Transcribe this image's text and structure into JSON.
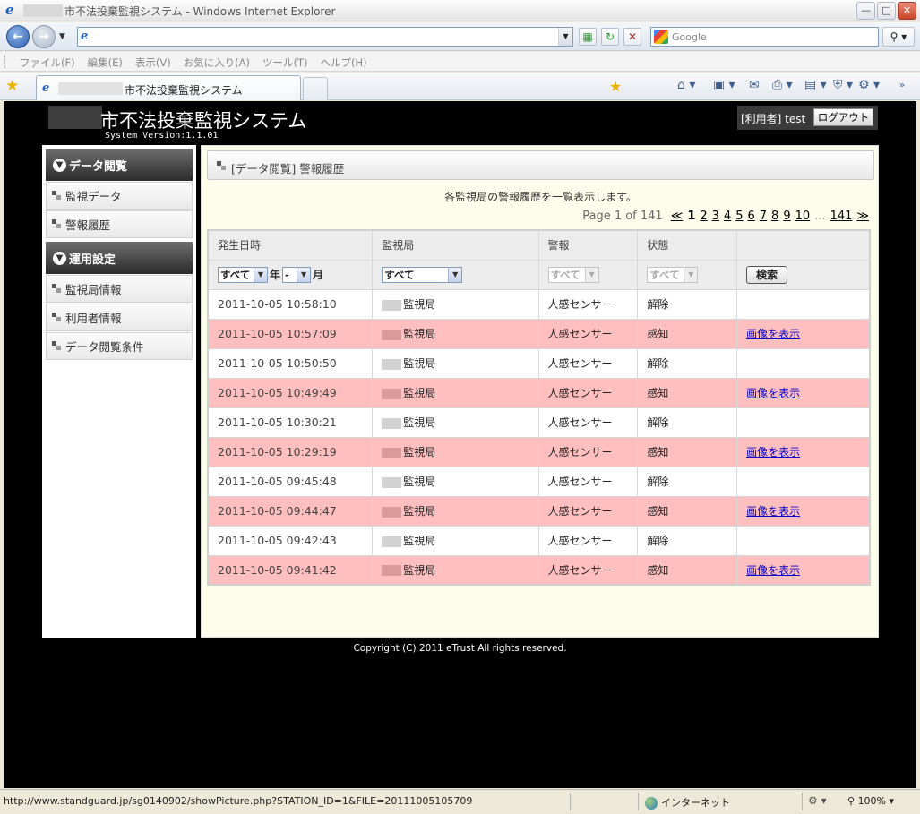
{
  "browser": {
    "title": "市不法投棄監視システム - Windows Internet Explorer",
    "search_placeholder": "Google",
    "menu": [
      "ファイル(F)",
      "編集(E)",
      "表示(V)",
      "お気に入り(A)",
      "ツール(T)",
      "ヘルプ(H)"
    ],
    "tab_title": "市不法投棄監視システム",
    "status_url": "http://www.standguard.jp/sg0140902/showPicture.php?STATION_ID=1&FILE=20111005105709",
    "zone": "インターネット",
    "zoom": "100%"
  },
  "site": {
    "title": "市不法投棄監視システム",
    "version": "System Version:1.1.01",
    "user_label": "[利用者] test",
    "logout": "ログアウト",
    "copyright": "Copyright (C) 2011 eTrust All rights reserved."
  },
  "sidebar": {
    "sections": [
      {
        "title": "データ閲覧",
        "items": [
          "監視データ",
          "警報履歴"
        ]
      },
      {
        "title": "運用設定",
        "items": [
          "監視局情報",
          "利用者情報",
          "データ閲覧条件"
        ]
      }
    ]
  },
  "content": {
    "heading": "[データ閲覧] 警報履歴",
    "description": "各監視局の警報履歴を一覧表示します。",
    "pager": {
      "info": "Page 1 of 141",
      "first": "≪",
      "current": "1",
      "pages": [
        "2",
        "3",
        "4",
        "5",
        "6",
        "7",
        "8",
        "9",
        "10"
      ],
      "ellipsis": "...",
      "last_page": "141",
      "last": "≫"
    },
    "columns": [
      "発生日時",
      "監視局",
      "警報",
      "状態",
      ""
    ],
    "filters": {
      "year": "すべて",
      "year_suffix": "年",
      "month": "-",
      "month_suffix": "月",
      "station": "すべて",
      "alarm": "すべて",
      "state": "すべて",
      "search_button": "検索"
    },
    "rows": [
      {
        "datetime": "2011-10-05 10:58:10",
        "station": "監視局",
        "alarm": "人感センサー",
        "state": "解除",
        "action": "",
        "alert": false
      },
      {
        "datetime": "2011-10-05 10:57:09",
        "station": "監視局",
        "alarm": "人感センサー",
        "state": "感知",
        "action": "画像を表示",
        "alert": true
      },
      {
        "datetime": "2011-10-05 10:50:50",
        "station": "監視局",
        "alarm": "人感センサー",
        "state": "解除",
        "action": "",
        "alert": false
      },
      {
        "datetime": "2011-10-05 10:49:49",
        "station": "監視局",
        "alarm": "人感センサー",
        "state": "感知",
        "action": "画像を表示",
        "alert": true
      },
      {
        "datetime": "2011-10-05 10:30:21",
        "station": "監視局",
        "alarm": "人感センサー",
        "state": "解除",
        "action": "",
        "alert": false
      },
      {
        "datetime": "2011-10-05 10:29:19",
        "station": "監視局",
        "alarm": "人感センサー",
        "state": "感知",
        "action": "画像を表示",
        "alert": true
      },
      {
        "datetime": "2011-10-05 09:45:48",
        "station": "監視局",
        "alarm": "人感センサー",
        "state": "解除",
        "action": "",
        "alert": false
      },
      {
        "datetime": "2011-10-05 09:44:47",
        "station": "監視局",
        "alarm": "人感センサー",
        "state": "感知",
        "action": "画像を表示",
        "alert": true
      },
      {
        "datetime": "2011-10-05 09:42:43",
        "station": "監視局",
        "alarm": "人感センサー",
        "state": "解除",
        "action": "",
        "alert": false
      },
      {
        "datetime": "2011-10-05 09:41:42",
        "station": "監視局",
        "alarm": "人感センサー",
        "state": "感知",
        "action": "画像を表示",
        "alert": true
      }
    ]
  },
  "colors": {
    "alert_row": "#ffbfbf",
    "content_bg": "#fdfdeb",
    "page_bg": "#000000",
    "link": "#0000cc"
  }
}
